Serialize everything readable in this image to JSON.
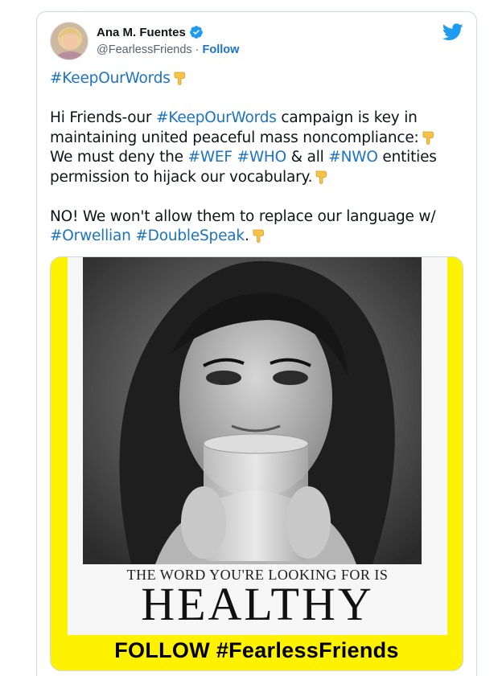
{
  "tweet": {
    "author_name": "Ana M. Fuentes",
    "handle": "@FearlessFriends",
    "separator": "·",
    "follow_label": "Follow",
    "verified_icon": "verified-badge-icon",
    "platform_icon": "twitter-bird-icon",
    "accent_color": "#1b73c4",
    "hashtag_header": "#KeepOurWords",
    "para1": {
      "t1": "Hi Friends-our ",
      "h1": "#KeepOurWords",
      "t2": " campaign is key in maintaining united peaceful mass noncompliance:",
      "t3": " We must deny the ",
      "h2": "#WEF",
      "t4": " ",
      "h3": "#WHO",
      "t5": " & all ",
      "h4": "#NWO",
      "t6": " entities permission to hijack our vocabulary."
    },
    "para2": {
      "t1": "NO! We won't allow them to replace our language w/ ",
      "h1": "#Orwellian",
      "t2": " ",
      "h2": "#DoubleSpeak",
      "t3": "."
    },
    "emoji": "backhand-index-pointing-down"
  },
  "media": {
    "caption_small": "THE WORD YOU'RE LOOKING FOR IS",
    "caption_big": "HEALTHY",
    "banner": "FOLLOW #FearlessFriends",
    "frame_color": "#fff200"
  }
}
